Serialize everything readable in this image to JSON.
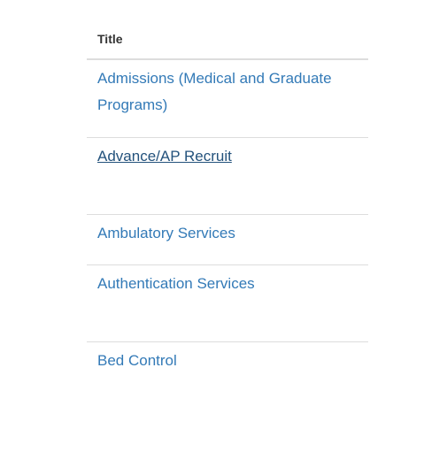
{
  "table": {
    "header": "Title",
    "rows": [
      {
        "title": "Admissions (Medical and Graduate Programs)"
      },
      {
        "title": "Advance/AP Recruit"
      },
      {
        "title": "Ambulatory Services"
      },
      {
        "title": "Authentication Services"
      },
      {
        "title": "Bed Control"
      }
    ]
  },
  "colors": {
    "link": "#337ab7",
    "link_hover": "#23527c",
    "header_text": "#333333",
    "border": "#dddddd"
  }
}
